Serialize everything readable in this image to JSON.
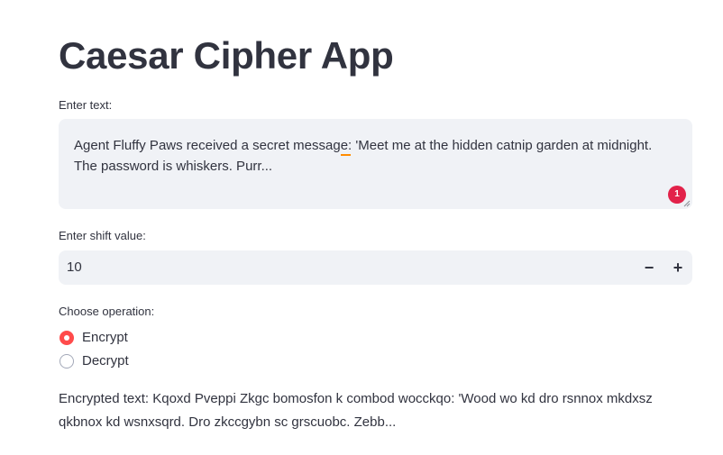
{
  "app": {
    "title": "Caesar Cipher App"
  },
  "text_input": {
    "label": "Enter text:",
    "value": "Agent Fluffy Paws received a secret message: 'Meet me at the hidden catnip garden at midnight. The password is whiskers. Purr...",
    "spellcheck_badge": "1"
  },
  "shift_input": {
    "label": "Enter shift value:",
    "value": "10",
    "decrement_label": "−",
    "increment_label": "+"
  },
  "operation": {
    "label": "Choose operation:",
    "options": [
      {
        "label": "Encrypt",
        "selected": true
      },
      {
        "label": "Decrypt",
        "selected": false
      }
    ]
  },
  "result": {
    "text": "Encrypted text: Kqoxd Pveppi Zkgc bomosfon k combod wocckqo: 'Wood wo kd dro rsnnox mkdxsz qkbnox kd wsnxsqrd. Dro zkccgybn sc grscuobc. Zebb..."
  },
  "colors": {
    "accent": "#ff4b4b",
    "input_background": "#f0f2f6",
    "text": "#31333f",
    "badge": "#e2224a"
  }
}
